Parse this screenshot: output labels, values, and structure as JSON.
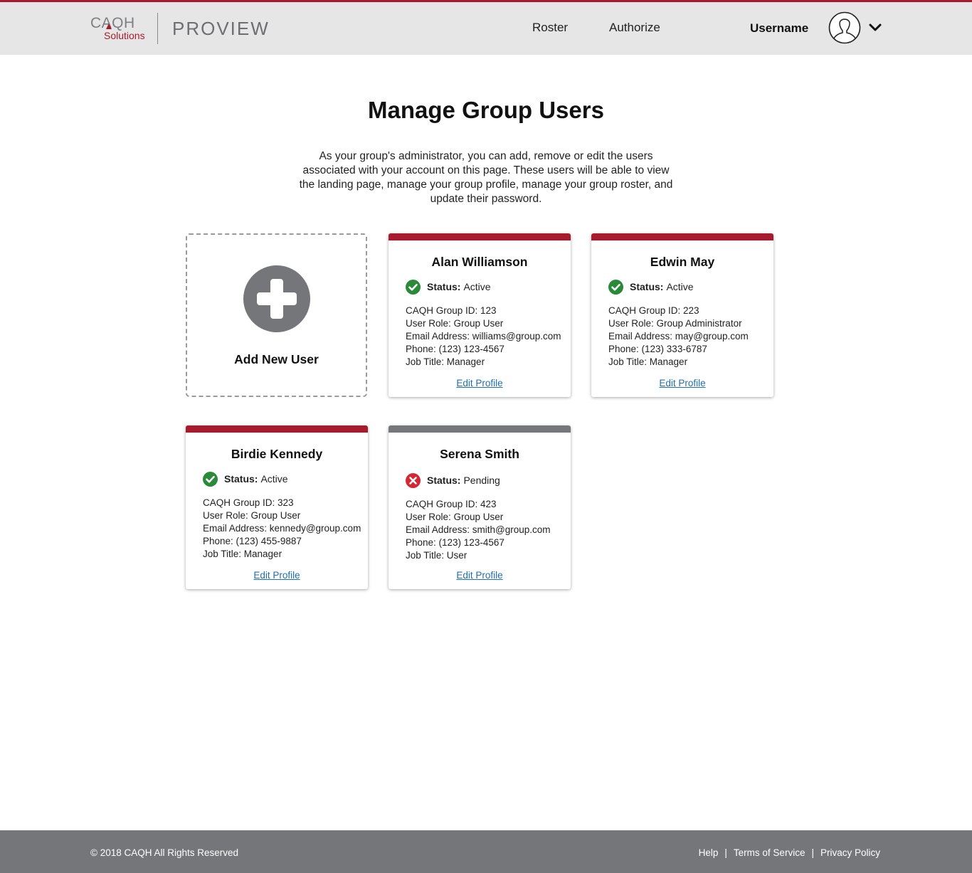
{
  "header": {
    "logo_caqh": "CAQH",
    "logo_solutions": "Solutions",
    "logo_proview": "PROVIEW",
    "nav": {
      "roster": "Roster",
      "authorize": "Authorize"
    },
    "username": "Username",
    "accent_color": "#a61c2e"
  },
  "main": {
    "title": "Manage Group Users",
    "intro": "As your group's administrator, you can add, remove or edit the users associated with your account on this page. These users will be able to view the landing page, manage your group profile, manage your group roster, and update their password.",
    "add_user_label": "Add New User",
    "status_label": "Status:",
    "edit_label": "Edit Profile",
    "users": [
      {
        "name": "Alan Williamson",
        "status": "Active",
        "group_id": "CAQH Group ID: 123",
        "role": "User Role: Group User",
        "email": "Email Address: williams@group.com",
        "phone": "Phone: (123) 123-4567",
        "job": "Job Title: Manager"
      },
      {
        "name": "Edwin May",
        "status": "Active",
        "group_id": "CAQH Group ID: 223",
        "role": "User Role: Group Administrator",
        "email": "Email Address: may@group.com",
        "phone": "Phone: (123) 333-6787",
        "job": "Job Title: Manager"
      },
      {
        "name": "Birdie Kennedy",
        "status": "Active",
        "group_id": "CAQH Group ID: 323",
        "role": "User Role: Group User",
        "email": "Email Address: kennedy@group.com",
        "phone": "Phone: (123) 455-9887",
        "job": "Job Title: Manager"
      },
      {
        "name": "Serena Smith",
        "status": "Pending",
        "group_id": "CAQH Group ID: 423",
        "role": "User Role: Group User",
        "email": "Email Address: smith@group.com",
        "phone": "Phone: (123) 123-4567",
        "job": "Job Title: User"
      }
    ]
  },
  "footer": {
    "copyright": "© 2018 CAQH All Rights Reserved",
    "links": {
      "help": "Help",
      "terms": "Terms of Service",
      "privacy": "Privacy Policy"
    },
    "separator": "|"
  }
}
